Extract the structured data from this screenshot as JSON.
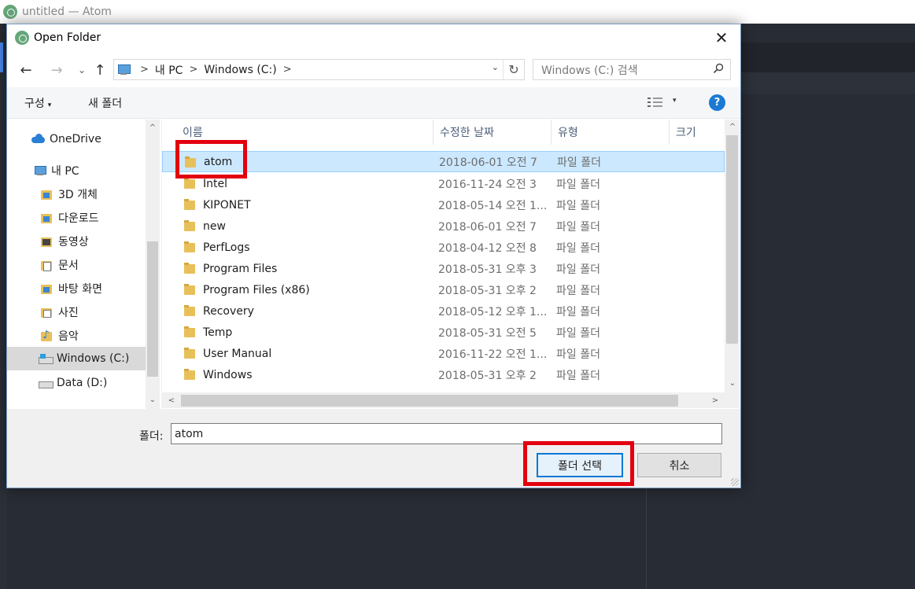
{
  "atom_window": {
    "title": "untitled — Atom"
  },
  "dialog": {
    "title": "Open Folder",
    "close_glyph": "✕",
    "nav": {
      "back_glyph": "←",
      "forward_glyph": "→",
      "recent_glyph": "⌄",
      "up_glyph": "↑"
    },
    "breadcrumb": {
      "items": [
        "내 PC",
        "Windows (C:)"
      ],
      "sep": ">"
    },
    "address_dropdown_glyph": "⌄",
    "refresh_glyph": "↻",
    "search": {
      "placeholder": "Windows (C:) 검색",
      "icon": "search-icon"
    },
    "toolbar": {
      "organize": "구성",
      "organize_caret": "▾",
      "new_folder": "새 폴더",
      "view_caret": "▾",
      "help": "?"
    },
    "nav_pane": {
      "items": [
        {
          "label": "OneDrive",
          "icon": "onedrive-icon"
        },
        {
          "label": "내 PC",
          "icon": "pc-icon"
        },
        {
          "label": "3D 개체",
          "icon": "folder-3d-icon"
        },
        {
          "label": "다운로드",
          "icon": "download-folder-icon"
        },
        {
          "label": "동영상",
          "icon": "video-folder-icon"
        },
        {
          "label": "문서",
          "icon": "documents-folder-icon"
        },
        {
          "label": "바탕 화면",
          "icon": "desktop-folder-icon"
        },
        {
          "label": "사진",
          "icon": "pictures-folder-icon"
        },
        {
          "label": "음악",
          "icon": "music-folder-icon"
        },
        {
          "label": "Windows (C:)",
          "icon": "windows-drive-icon",
          "selected": true
        },
        {
          "label": "Data (D:)",
          "icon": "drive-icon"
        }
      ]
    },
    "columns": {
      "name": "이름",
      "date": "수정한 날짜",
      "type": "유형",
      "size": "크기",
      "sort_glyph": "^"
    },
    "files": [
      {
        "name": "atom",
        "date": "2018-06-01 오전 7",
        "type": "파일 폴더",
        "selected": true
      },
      {
        "name": "Intel",
        "date": "2016-11-24 오전 3",
        "type": "파일 폴더"
      },
      {
        "name": "KIPONET",
        "date": "2018-05-14 오전 1...",
        "type": "파일 폴더"
      },
      {
        "name": "new",
        "date": "2018-06-01 오전 7",
        "type": "파일 폴더"
      },
      {
        "name": "PerfLogs",
        "date": "2018-04-12 오전 8",
        "type": "파일 폴더"
      },
      {
        "name": "Program Files",
        "date": "2018-05-31 오후 3",
        "type": "파일 폴더"
      },
      {
        "name": "Program Files (x86)",
        "date": "2018-05-31 오후 2",
        "type": "파일 폴더"
      },
      {
        "name": "Recovery",
        "date": "2018-05-12 오후 1...",
        "type": "파일 폴더"
      },
      {
        "name": "Temp",
        "date": "2018-05-31 오전 5",
        "type": "파일 폴더"
      },
      {
        "name": "User Manual",
        "date": "2016-11-22 오전 1...",
        "type": "파일 폴더"
      },
      {
        "name": "Windows",
        "date": "2018-05-31 오후 2",
        "type": "파일 폴더"
      }
    ],
    "scroll_glyphs": {
      "up": "^",
      "down": "⌄",
      "left": "<",
      "right": ">"
    },
    "folder_field": {
      "label": "폴더:",
      "value": "atom"
    },
    "buttons": {
      "select": "폴더 선택",
      "cancel": "취소"
    }
  },
  "colors": {
    "highlight_box": "#e3000f",
    "selected_row": "#cce8ff",
    "primary_button_border": "#0078d7"
  }
}
